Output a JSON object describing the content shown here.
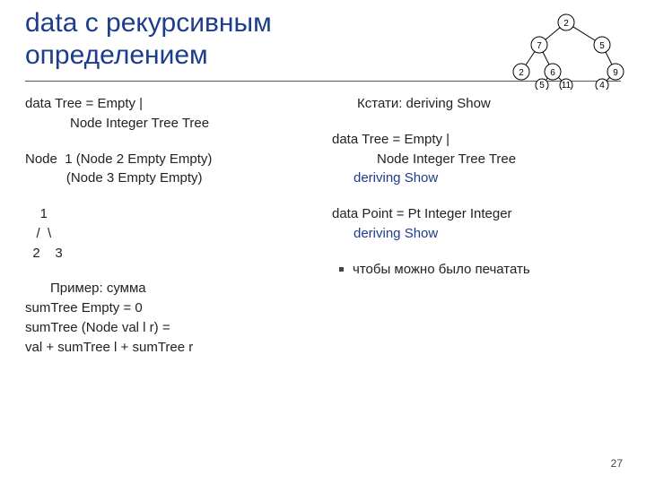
{
  "title": "data с рекурсивным определением",
  "left": {
    "code1": "data Tree = Empty |\n            Node Integer Tree Tree",
    "code2": "Node  1 (Node 2 Empty Empty)\n           (Node 3 Empty Empty)",
    "ascii_tree": "    1\n   /  \\\n  2    3",
    "example_label": "Пример: сумма",
    "sum1": "sumTree Empty = 0",
    "sum2": "sumTree (Node val l r) =",
    "sum3": "   val + sumTree l + sumTree r"
  },
  "right": {
    "bullet1": "Кстати: deriving Show",
    "code1": "data Tree = Empty |\n            Node Integer Tree Tree",
    "deriv1": "deriving Show",
    "code2": "data Point = Pt Integer Integer",
    "deriv2": "deriving Show",
    "bullet2": "чтобы можно было печатать"
  },
  "tree_diagram": {
    "nodes": [
      2,
      7,
      5,
      2,
      6,
      9,
      5,
      11,
      4
    ],
    "edges": [
      [
        0,
        1
      ],
      [
        0,
        2
      ],
      [
        1,
        3
      ],
      [
        1,
        4
      ],
      [
        2,
        5
      ],
      [
        4,
        6
      ],
      [
        4,
        7
      ],
      [
        5,
        8
      ]
    ]
  },
  "page_number": "27"
}
